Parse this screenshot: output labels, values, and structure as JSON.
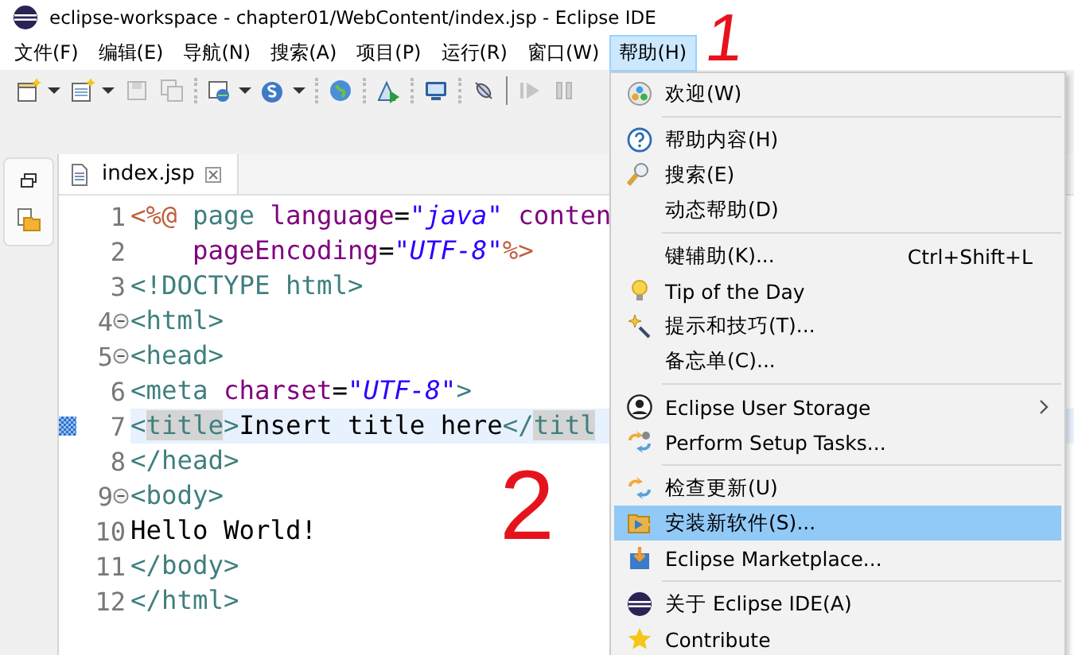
{
  "window": {
    "title": "eclipse-workspace - chapter01/WebContent/index.jsp - Eclipse IDE"
  },
  "menu_bar": [
    {
      "label": "文件(F)",
      "selected": false
    },
    {
      "label": "编辑(E)",
      "selected": false
    },
    {
      "label": "导航(N)",
      "selected": false
    },
    {
      "label": "搜索(A)",
      "selected": false
    },
    {
      "label": "项目(P)",
      "selected": false
    },
    {
      "label": "运行(R)",
      "selected": false
    },
    {
      "label": "窗口(W)",
      "selected": false
    },
    {
      "label": "帮助(H)",
      "selected": true
    }
  ],
  "editor": {
    "tab": {
      "label": "index.jsp"
    },
    "lines": [
      {
        "number": "1",
        "fold": false,
        "current": false,
        "tokens": [
          {
            "kind": "jsp",
            "text": "<%@"
          },
          {
            "kind": "tag",
            "text": " page"
          },
          {
            "kind": "attr",
            "text": " language"
          },
          {
            "kind": "plain",
            "text": "="
          },
          {
            "kind": "value",
            "text": "\"java\""
          },
          {
            "kind": "attr",
            "text": " conten"
          }
        ]
      },
      {
        "number": "2",
        "fold": false,
        "current": false,
        "tokens": [
          {
            "kind": "attr",
            "text": "    pageEncoding"
          },
          {
            "kind": "plain",
            "text": "="
          },
          {
            "kind": "value",
            "text": "\"UTF-8\""
          },
          {
            "kind": "jsp",
            "text": "%>"
          }
        ]
      },
      {
        "number": "3",
        "fold": false,
        "current": false,
        "tokens": [
          {
            "kind": "tag",
            "text": "<!DOCTYPE html>"
          }
        ]
      },
      {
        "number": "4",
        "fold": true,
        "current": false,
        "tokens": [
          {
            "kind": "tag",
            "text": "<html>"
          }
        ]
      },
      {
        "number": "5",
        "fold": true,
        "current": false,
        "tokens": [
          {
            "kind": "tag",
            "text": "<head>"
          }
        ]
      },
      {
        "number": "6",
        "fold": false,
        "current": false,
        "tokens": [
          {
            "kind": "tag",
            "text": "<meta"
          },
          {
            "kind": "attr",
            "text": " charset"
          },
          {
            "kind": "plain",
            "text": "="
          },
          {
            "kind": "value",
            "text": "\"UTF-8\""
          },
          {
            "kind": "tag",
            "text": ">"
          }
        ]
      },
      {
        "number": "7",
        "fold": false,
        "current": true,
        "tokens": [
          {
            "kind": "tag",
            "text": "<"
          },
          {
            "kind": "match",
            "text": "title"
          },
          {
            "kind": "tag",
            "text": ">"
          },
          {
            "kind": "plain",
            "text": "Insert title here"
          },
          {
            "kind": "tag",
            "text": "</"
          },
          {
            "kind": "match",
            "text": "titl"
          }
        ]
      },
      {
        "number": "8",
        "fold": false,
        "current": false,
        "tokens": [
          {
            "kind": "tag",
            "text": "</head>"
          }
        ]
      },
      {
        "number": "9",
        "fold": true,
        "current": false,
        "tokens": [
          {
            "kind": "tag",
            "text": "<body>"
          }
        ]
      },
      {
        "number": "10",
        "fold": false,
        "current": false,
        "tokens": [
          {
            "kind": "plain",
            "text": "Hello World!"
          }
        ]
      },
      {
        "number": "11",
        "fold": false,
        "current": false,
        "tokens": [
          {
            "kind": "tag",
            "text": "</body>"
          }
        ]
      },
      {
        "number": "12",
        "fold": false,
        "current": false,
        "tokens": [
          {
            "kind": "tag",
            "text": "</html>"
          }
        ]
      }
    ]
  },
  "help_menu": {
    "sections": [
      [
        {
          "label": "欢迎(W)",
          "submenu": false,
          "selected": false
        }
      ],
      [
        {
          "label": "帮助内容(H)",
          "submenu": false,
          "selected": false
        },
        {
          "label": "搜索(E)",
          "submenu": false,
          "selected": false
        },
        {
          "label": "动态帮助(D)",
          "submenu": false,
          "selected": false
        }
      ],
      [
        {
          "label": "键辅助(K)...",
          "shortcut": "Ctrl+Shift+L",
          "submenu": false,
          "selected": false
        },
        {
          "label": "Tip of the Day",
          "submenu": false,
          "selected": false
        },
        {
          "label": "提示和技巧(T)...",
          "submenu": false,
          "selected": false
        },
        {
          "label": "备忘单(C)...",
          "submenu": false,
          "selected": false
        }
      ],
      [
        {
          "label": "Eclipse User Storage",
          "submenu": true,
          "selected": false
        },
        {
          "label": "Perform Setup Tasks...",
          "submenu": false,
          "selected": false
        }
      ],
      [
        {
          "label": "检查更新(U)",
          "submenu": false,
          "selected": false
        },
        {
          "label": "安装新软件(S)...",
          "submenu": false,
          "selected": true
        },
        {
          "label": "Eclipse Marketplace...",
          "submenu": false,
          "selected": false
        }
      ],
      [
        {
          "label": "关于 Eclipse IDE(A)",
          "submenu": false,
          "selected": false
        },
        {
          "label": "Contribute",
          "submenu": false,
          "selected": false
        }
      ]
    ]
  },
  "annotations": [
    {
      "text": "1"
    },
    {
      "text": "2"
    }
  ]
}
